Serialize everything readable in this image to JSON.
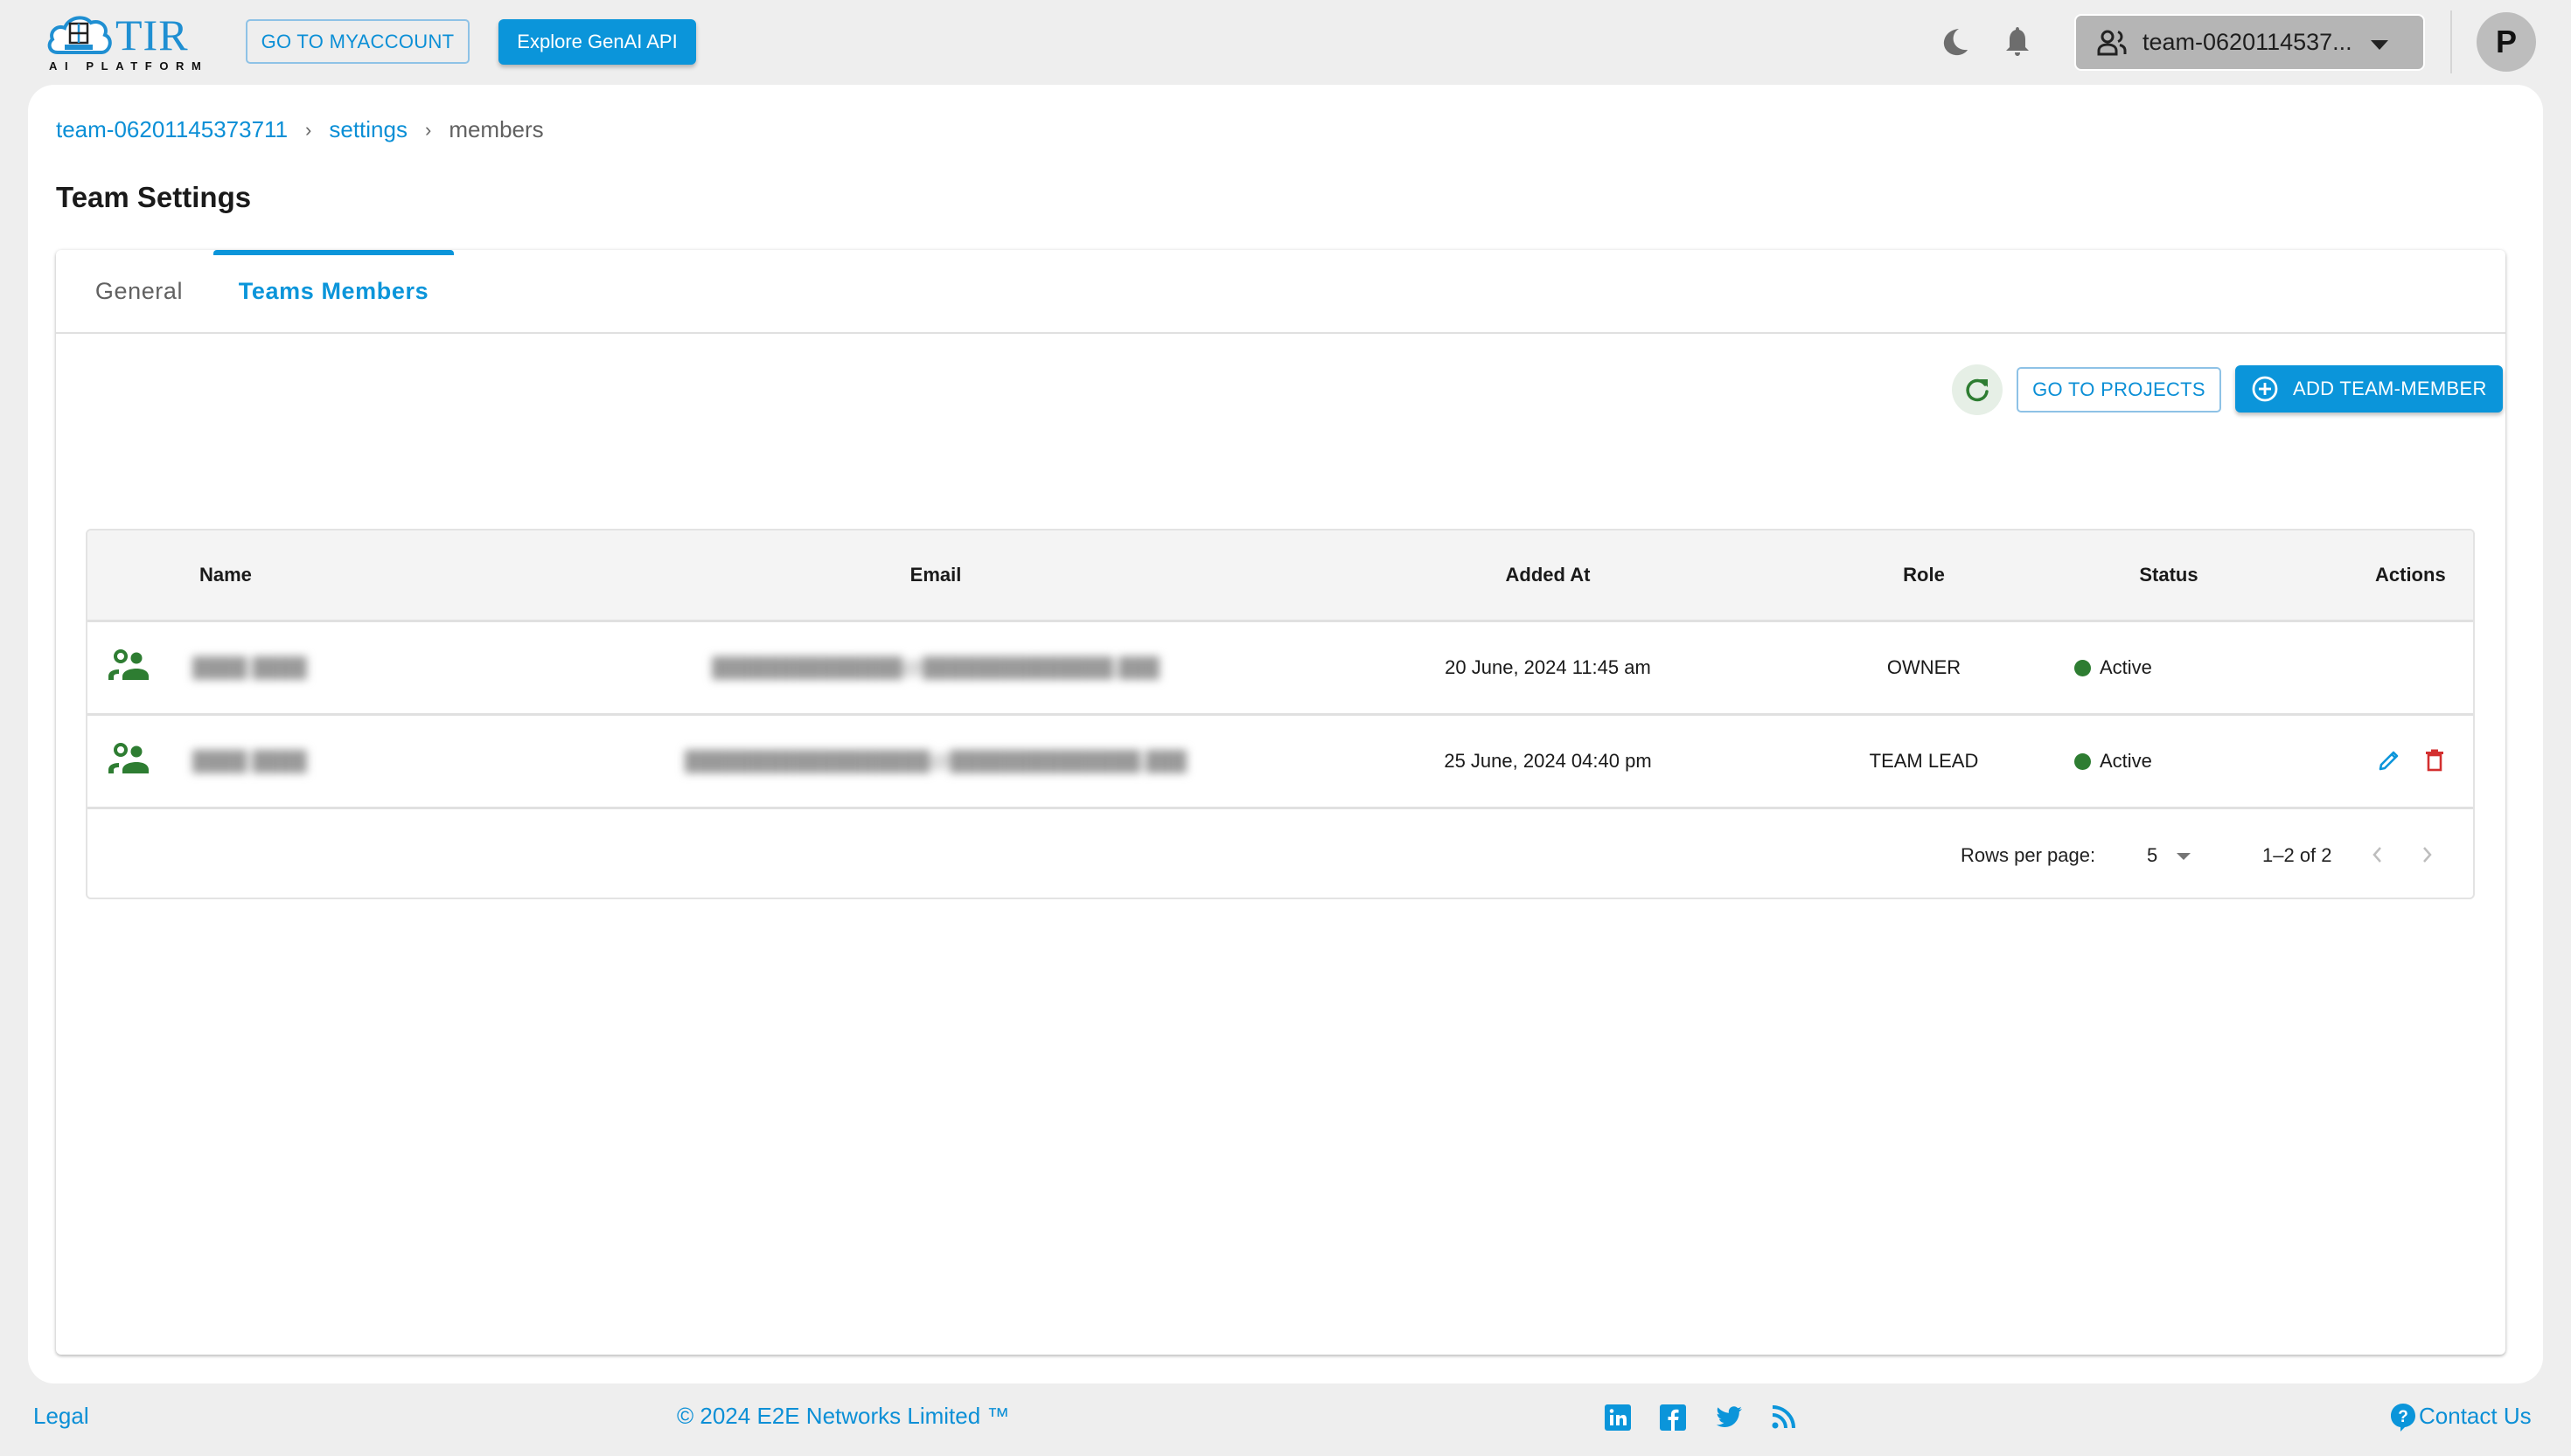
{
  "header": {
    "logo": {
      "title": "TIR",
      "subtitle": "AI PLATFORM",
      "badge": "E2E Cloud"
    },
    "myaccount_label": "GO TO MYACCOUNT",
    "genai_label": "Explore GenAI API",
    "icons": [
      "moon-icon",
      "bell-icon"
    ],
    "team_select": {
      "value": "team-0620114537...",
      "icon": "people-icon"
    },
    "avatar_initial": "P"
  },
  "breadcrumb": [
    {
      "label": "team-06201145373711",
      "link": true
    },
    {
      "label": "settings",
      "link": true
    },
    {
      "label": "members",
      "link": false
    }
  ],
  "breadcrumb_sep": "›",
  "page_title": "Team Settings",
  "tabs": [
    {
      "label": "General",
      "active": false
    },
    {
      "label": "Teams Members",
      "active": true
    }
  ],
  "toolbar": {
    "refresh_icon": "refresh-icon",
    "projects_label": "GO TO PROJECTS",
    "add_label": "ADD TEAM-MEMBER"
  },
  "table": {
    "columns": [
      "Name",
      "Email",
      "Added At",
      "Role",
      "Status",
      "Actions"
    ],
    "rows": [
      {
        "name": "████ ████",
        "email": "██████████████@██████████████.███",
        "added_at": "20 June, 2024 11:45 am",
        "role": "OWNER",
        "status": "Active",
        "actions": []
      },
      {
        "name": "████ ████",
        "email": "██████████████████@██████████████.███",
        "added_at": "25 June, 2024 04:40 pm",
        "role": "TEAM LEAD",
        "status": "Active",
        "actions": [
          "edit",
          "delete"
        ]
      }
    ],
    "pagination": {
      "rows_per_page_label": "Rows per page:",
      "rows_per_page": "5",
      "range": "1–2 of 2"
    }
  },
  "colors": {
    "accent": "#0b95da",
    "status_active": "#2e7d32",
    "delete": "#d32f2f",
    "user_icon": "#2e7d32"
  },
  "footer": {
    "legal": "Legal",
    "copyright": "© 2024 E2E Networks Limited ™",
    "social": [
      "linkedin",
      "facebook",
      "twitter",
      "rss"
    ],
    "contact": "Contact Us"
  }
}
